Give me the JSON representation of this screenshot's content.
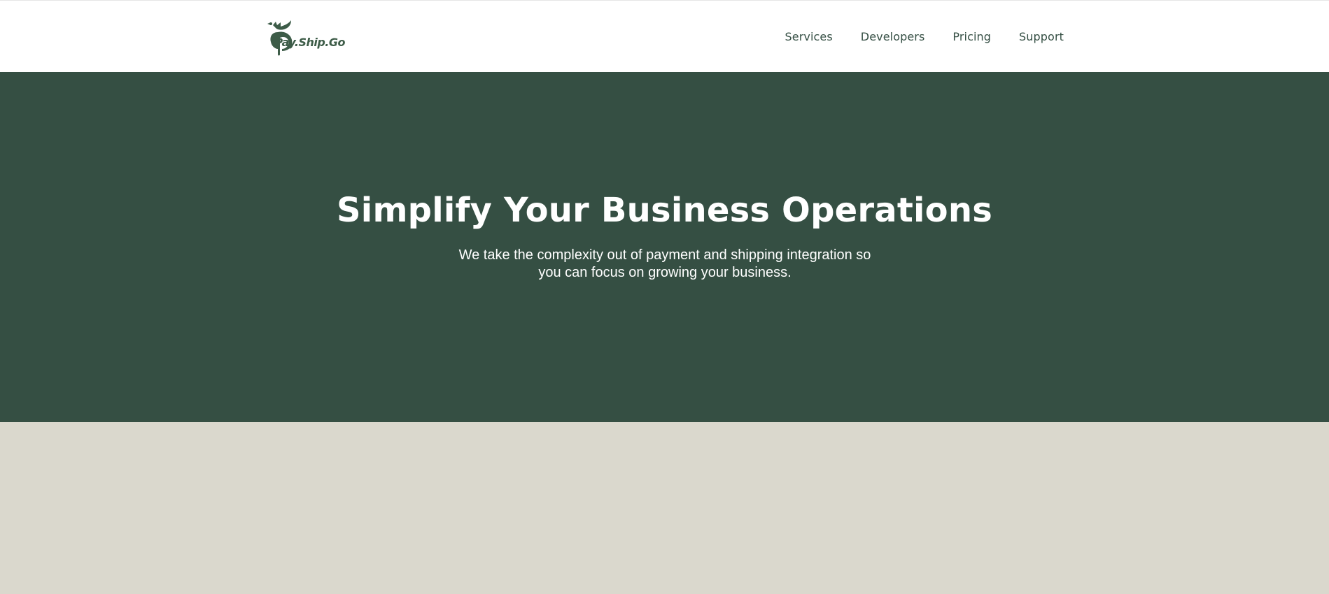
{
  "header": {
    "logo_text": "Pay.Ship.Go",
    "logo_icon": "bird-p-logo-icon",
    "nav": [
      {
        "label": "Services"
      },
      {
        "label": "Developers"
      },
      {
        "label": "Pricing"
      },
      {
        "label": "Support"
      }
    ]
  },
  "hero": {
    "title": "Simplify Your Business Operations",
    "subtitle": "We take the complexity out of payment and shipping integration so you can focus on growing your business."
  },
  "colors": {
    "brand_green": "#354f43",
    "band_beige": "#dad8cd",
    "nav_text": "#354f44",
    "white": "#ffffff"
  }
}
